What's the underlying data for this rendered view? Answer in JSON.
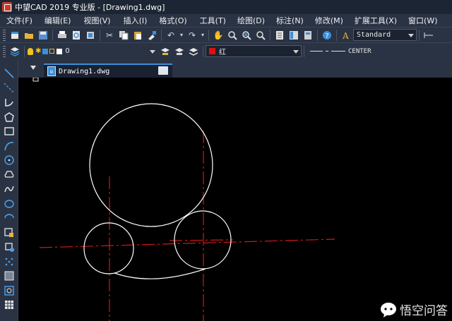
{
  "window": {
    "title": "中望CAD 2019 专业版 - [Drawing1.dwg]"
  },
  "menu": [
    "文件(F)",
    "编辑(E)",
    "视图(V)",
    "插入(I)",
    "格式(O)",
    "工具(T)",
    "绘图(D)",
    "标注(N)",
    "修改(M)",
    "扩展工具(X)",
    "窗口(W)"
  ],
  "toolbar1": {
    "textstyle_value": "Standard"
  },
  "toolbar2": {
    "layer_value": "0",
    "color_value": "红",
    "linetype_value": "CENTER"
  },
  "tabs": [
    {
      "label": "Drawing1.dwg"
    }
  ],
  "colors": {
    "object_line": "#ffffff",
    "center_line": "#d01818",
    "canvas": "#000000",
    "accent": "#3c8fd8"
  },
  "watermark": {
    "text": "悟空问答"
  }
}
